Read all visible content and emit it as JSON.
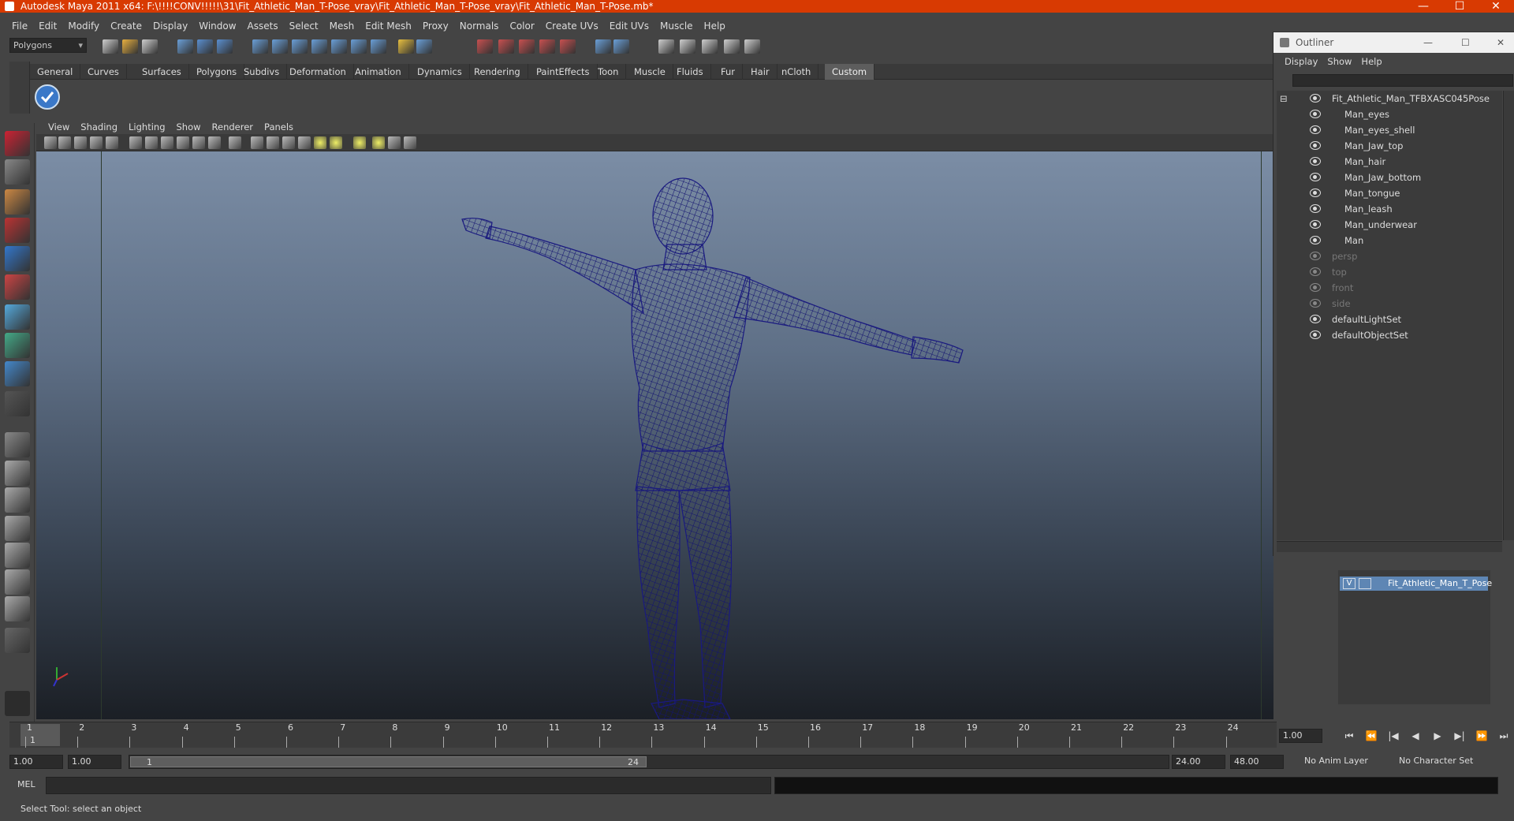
{
  "window": {
    "title": "Autodesk Maya 2011 x64: F:\\!!!!CONV!!!!!\\31\\Fit_Athletic_Man_T-Pose_vray\\Fit_Athletic_Man_T-Pose_vray\\Fit_Athletic_Man_T-Pose.mb*",
    "minimize": "—",
    "maximize": "☐",
    "close": "✕"
  },
  "menubar": [
    "File",
    "Edit",
    "Modify",
    "Create",
    "Display",
    "Window",
    "Assets",
    "Select",
    "Mesh",
    "Edit Mesh",
    "Proxy",
    "Normals",
    "Color",
    "Create UVs",
    "Edit UVs",
    "Muscle",
    "Help"
  ],
  "statusline": {
    "mode": "Polygons"
  },
  "shelf": {
    "tabs": [
      "General",
      "Curves",
      "Surfaces",
      "Polygons",
      "Subdivs",
      "Deformation",
      "Animation",
      "Dynamics",
      "Rendering",
      "PaintEffects",
      "Toon",
      "Muscle",
      "Fluids",
      "Fur",
      "Hair",
      "nCloth",
      "Custom"
    ],
    "active_tab": "Custom"
  },
  "panel_menu": [
    "View",
    "Shading",
    "Lighting",
    "Show",
    "Renderer",
    "Panels"
  ],
  "outliner": {
    "title": "Outliner",
    "menu": [
      "Display",
      "Show",
      "Help"
    ],
    "items": [
      {
        "label": "Fit_Athletic_Man_TFBXASC045Pose",
        "level": 0,
        "dim": false
      },
      {
        "label": "Man_eyes",
        "level": 1,
        "dim": false
      },
      {
        "label": "Man_eyes_shell",
        "level": 1,
        "dim": false
      },
      {
        "label": "Man_Jaw_top",
        "level": 1,
        "dim": false
      },
      {
        "label": "Man_hair",
        "level": 1,
        "dim": false
      },
      {
        "label": "Man_Jaw_bottom",
        "level": 1,
        "dim": false
      },
      {
        "label": "Man_tongue",
        "level": 1,
        "dim": false
      },
      {
        "label": "Man_leash",
        "level": 1,
        "dim": false
      },
      {
        "label": "Man_underwear",
        "level": 1,
        "dim": false
      },
      {
        "label": "Man",
        "level": 1,
        "dim": false
      },
      {
        "label": "persp",
        "level": 0,
        "dim": true
      },
      {
        "label": "top",
        "level": 0,
        "dim": true
      },
      {
        "label": "front",
        "level": 0,
        "dim": true
      },
      {
        "label": "side",
        "level": 0,
        "dim": true
      },
      {
        "label": "defaultLightSet",
        "level": 0,
        "dim": false
      },
      {
        "label": "defaultObjectSet",
        "level": 0,
        "dim": false
      }
    ]
  },
  "layers": {
    "visible_flag": "V",
    "layer_name": "Fit_Athletic_Man_T_Pose"
  },
  "timeslider": {
    "frames": [
      "1",
      "2",
      "3",
      "4",
      "5",
      "6",
      "7",
      "8",
      "9",
      "10",
      "11",
      "12",
      "13",
      "14",
      "15",
      "16",
      "17",
      "18",
      "19",
      "20",
      "21",
      "22",
      "23",
      "24"
    ],
    "current_frame_label": "1",
    "current_time": "1.00"
  },
  "range": {
    "start_time": "1.00",
    "playback_start": "1.00",
    "handle_start": "1",
    "handle_end": "24",
    "playback_end": "24.00",
    "end_time": "48.00",
    "anim_layer": "No Anim Layer",
    "character_set": "No Character Set"
  },
  "playback_buttons": [
    "⏮",
    "⏪",
    "|◀",
    "◀",
    "▶",
    "▶|",
    "⏩",
    "⏭"
  ],
  "command_line": {
    "label": "MEL"
  },
  "help_line": {
    "text": "Select Tool: select an object"
  },
  "colors": {
    "titlebar": "#d83a02",
    "wireframe": "#141470",
    "layer_selected": "#5e86b4"
  }
}
